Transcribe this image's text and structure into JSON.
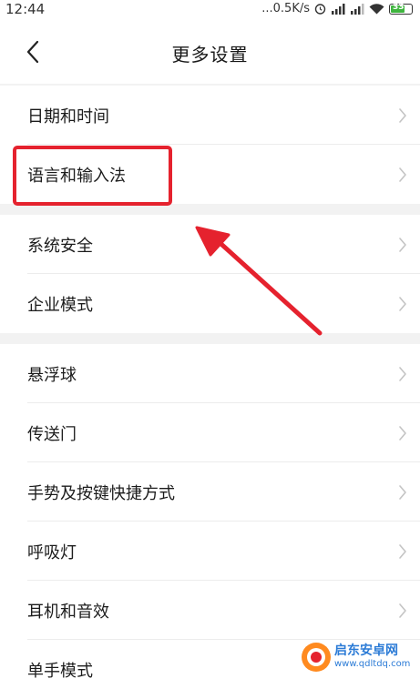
{
  "status_bar": {
    "time": "12:44",
    "network_speed": "...0.5K/s",
    "battery_level": "33",
    "icons": [
      "alarm-icon",
      "signal-icon",
      "signal-icon",
      "wifi-icon",
      "battery-icon"
    ]
  },
  "header": {
    "title": "更多设置",
    "back_icon": "chevron-left-icon"
  },
  "groups": [
    {
      "items": [
        {
          "label": "日期和时间"
        },
        {
          "label": "语言和输入法"
        }
      ]
    },
    {
      "items": [
        {
          "label": "系统安全"
        },
        {
          "label": "企业模式"
        }
      ]
    },
    {
      "items": [
        {
          "label": "悬浮球"
        },
        {
          "label": "传送门"
        },
        {
          "label": "手势及按键快捷方式"
        },
        {
          "label": "呼吸灯"
        },
        {
          "label": "耳机和音效"
        },
        {
          "label": "单手模式"
        }
      ]
    }
  ],
  "annotation": {
    "highlight_color": "#e5222e",
    "arrow_color": "#e5222e"
  },
  "watermark": {
    "title": "启东安卓网",
    "url": "www.qdltdq.com"
  },
  "colors": {
    "background": "#ffffff",
    "group_gap": "#f2f2f2",
    "divider": "#ececec",
    "chevron": "#c4c4c4"
  }
}
